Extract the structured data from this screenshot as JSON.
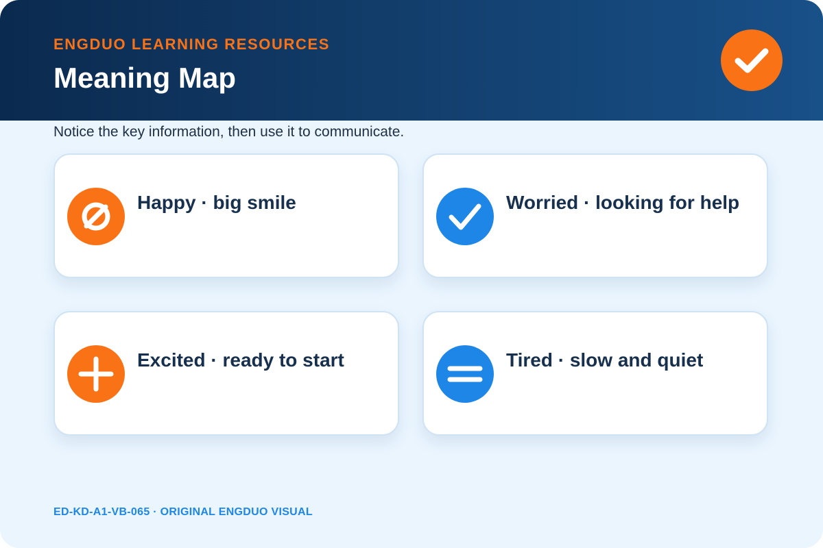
{
  "header": {
    "brand": "ENGDUO LEARNING RESOURCES",
    "title": "Meaning Map",
    "badge_icon": "check-icon"
  },
  "subtitle": "Notice the key information, then use it to communicate.",
  "cards": [
    {
      "label": "Happy · big smile",
      "icon": "empty-set-icon",
      "color": "#f97316"
    },
    {
      "label": "Worried · looking for help",
      "icon": "check-icon",
      "color": "#1e86e6"
    },
    {
      "label": "Excited · ready to start",
      "icon": "plus-icon",
      "color": "#f97316"
    },
    {
      "label": "Tired · slow and quiet",
      "icon": "equals-icon",
      "color": "#1e86e6"
    }
  ],
  "footer": "ED-KD-A1-VB-065 · ORIGINAL ENGDUO VISUAL",
  "colors": {
    "header_dark": "#0b2a4f",
    "header_light": "#185088",
    "accent_orange": "#f97316",
    "accent_blue": "#1e86e6",
    "background": "#eaf5fe",
    "text_dark": "#17304d"
  }
}
